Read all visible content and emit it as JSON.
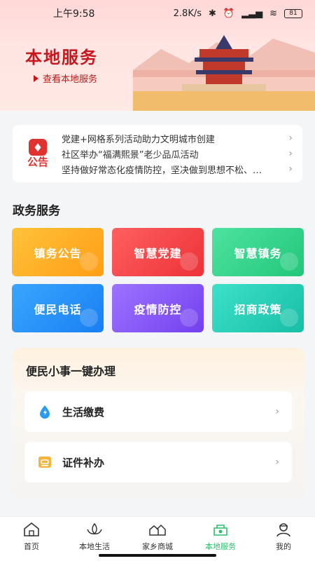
{
  "status": {
    "time": "上午9:58",
    "network": "2.8K/s",
    "battery": "81"
  },
  "banner": {
    "title": "本地服务",
    "link": "查看本地服务"
  },
  "notice": {
    "logo_text": "公告",
    "items": [
      "党建+网格系列活动助力文明城市创建",
      "社区举办“福满熙景”老少品瓜活动",
      "坚持做好常态化疫情防控，坚决做到思想不松、…"
    ]
  },
  "gov_services": {
    "title": "政务服务",
    "tiles": [
      "镇务公告",
      "智慧党建",
      "智慧镇务",
      "便民电话",
      "疫情防控",
      "招商政策"
    ]
  },
  "quick": {
    "title": "便民小事一键办理",
    "rows": [
      "生活缴费",
      "证件补办"
    ]
  },
  "nav": {
    "items": [
      "首页",
      "本地生活",
      "家乡商城",
      "本地服务",
      "我的"
    ],
    "active": "本地服务"
  },
  "colors": {
    "accent": "#2dbf6c",
    "brand_red": "#c8161e"
  }
}
